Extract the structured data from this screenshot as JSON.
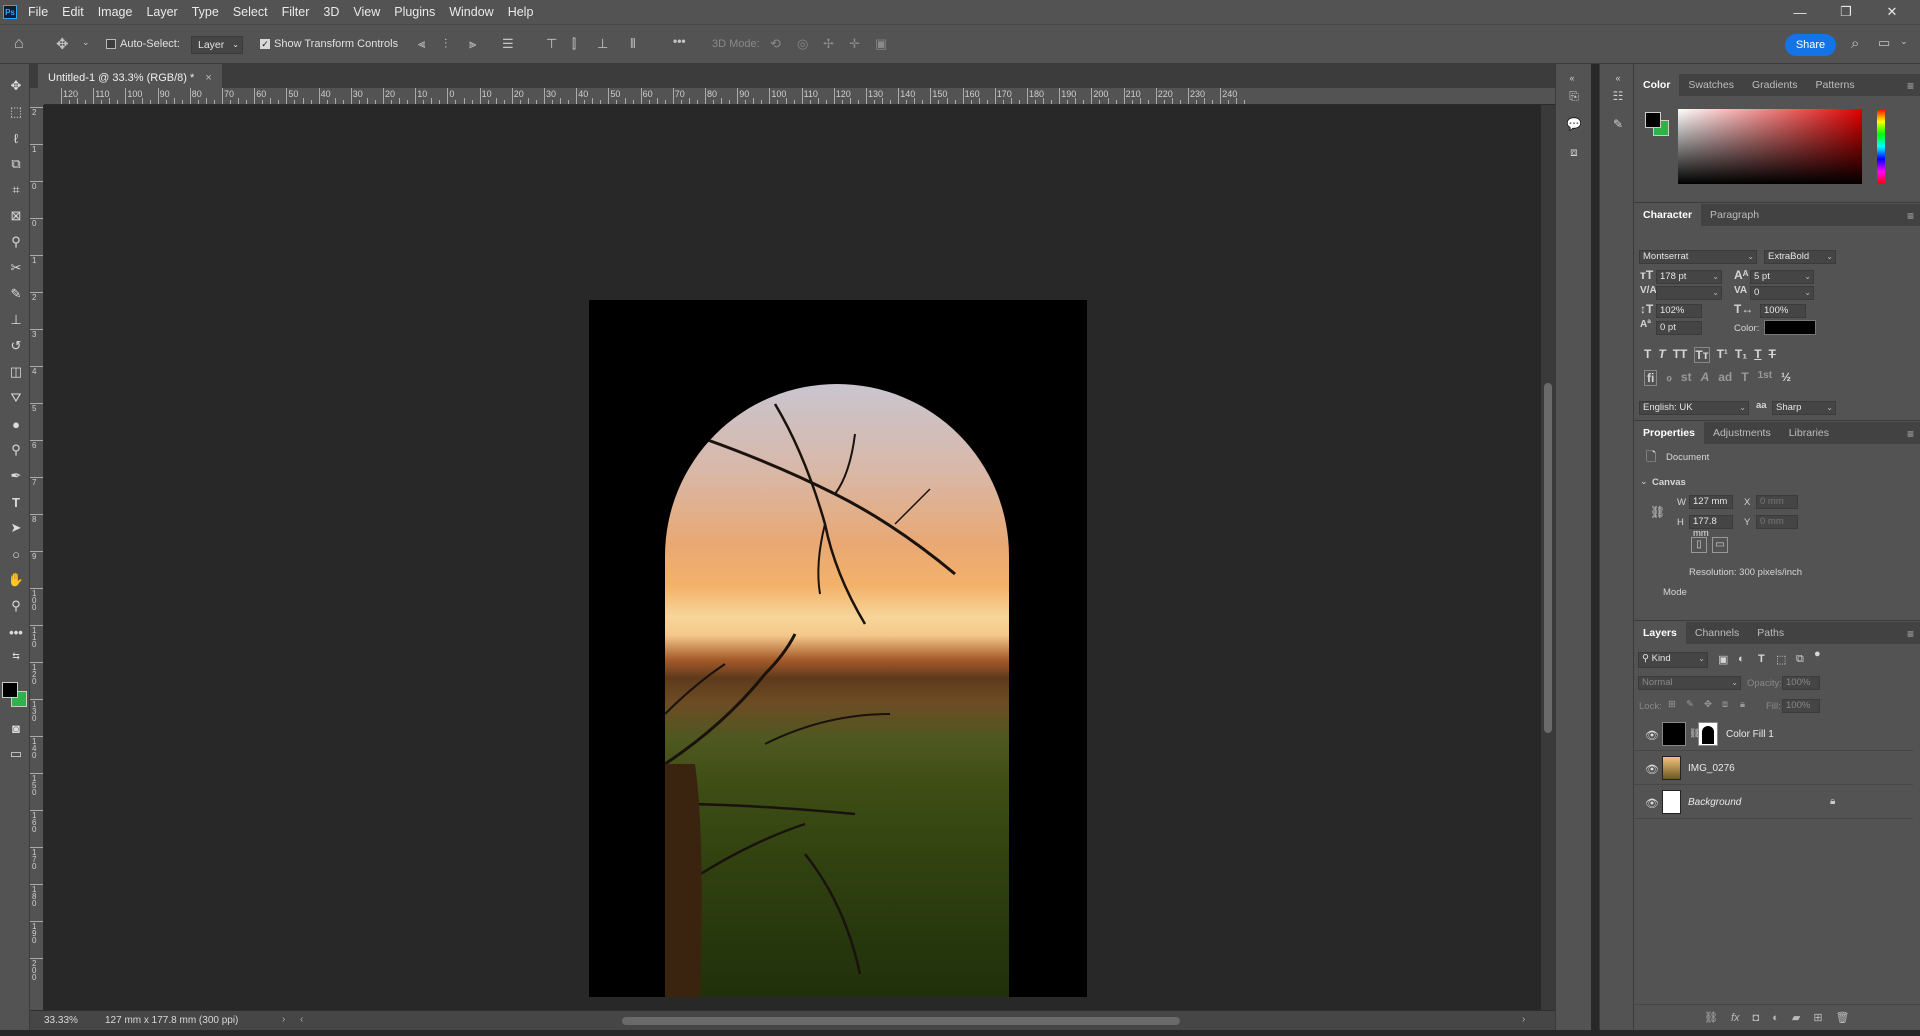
{
  "menubar": {
    "logo": "Ps",
    "items": [
      "File",
      "Edit",
      "Image",
      "Layer",
      "Type",
      "Select",
      "Filter",
      "3D",
      "View",
      "Plugins",
      "Window",
      "Help"
    ],
    "window_controls": {
      "minimize": "—",
      "restore": "❐",
      "close": "✕"
    }
  },
  "options": {
    "auto_select_label": "Auto-Select:",
    "auto_select_checked": false,
    "target_value": "Layer",
    "show_transform_label": "Show Transform Controls",
    "show_transform_checked": true,
    "mode_3d_label": "3D Mode:",
    "more_label": "•••",
    "share_label": "Share"
  },
  "document": {
    "tab_title": "Untitled-1 @ 33.3% (RGB/8) *",
    "close_glyph": "×"
  },
  "ruler": {
    "labels": [
      "120",
      "110",
      "100",
      "90",
      "80",
      "70",
      "60",
      "50",
      "40",
      "30",
      "20",
      "10",
      "0",
      "10",
      "20",
      "30",
      "40",
      "50",
      "60",
      "70",
      "80",
      "90",
      "100",
      "110",
      "120",
      "130",
      "140",
      "150",
      "160",
      "170",
      "180",
      "190",
      "200",
      "210",
      "220",
      "230",
      "240"
    ],
    "v_labels": [
      "2",
      "1",
      "0",
      "0",
      "1",
      "2",
      "3",
      "4",
      "5",
      "6",
      "7",
      "8",
      "9",
      "1 0 0",
      "1 1 0",
      "1 2 0",
      "1 3 0",
      "1 4 0",
      "1 5 0",
      "1 6 0",
      "1 7 0",
      "1 8 0",
      "1 9 0",
      "2 0 0"
    ]
  },
  "status": {
    "zoom": "33.33%",
    "doc_info": "127 mm x 177.8 mm (300 ppi)"
  },
  "color_panel": {
    "tabs": [
      "Color",
      "Swatches",
      "Gradients",
      "Patterns"
    ],
    "active_tab": "Color",
    "foreground": "#000000",
    "background": "#2db34a"
  },
  "character_panel": {
    "tabs": [
      "Character",
      "Paragraph"
    ],
    "font_family": "Montserrat",
    "font_style": "ExtraBold",
    "font_size": "178 pt",
    "leading": "5 pt",
    "kerning": "",
    "tracking": "0",
    "vertical_scale": "102%",
    "horizontal_scale": "100%",
    "baseline_shift": "0 pt",
    "color_label": "Color:",
    "language": "English: UK",
    "antialias_icon": "aa",
    "antialias": "Sharp",
    "style_buttons": [
      "T",
      "T",
      "TT",
      "Tт",
      "T¹",
      "T₁",
      "T",
      "T"
    ],
    "opentype_buttons": [
      "fi",
      "ℴ",
      "st",
      "A",
      "ad",
      "T",
      "1st",
      "½"
    ]
  },
  "properties_panel": {
    "tabs": [
      "Properties",
      "Adjustments",
      "Libraries"
    ],
    "doc_label": "Document",
    "canvas_label": "Canvas",
    "w_label": "W",
    "w_value": "127 mm",
    "h_label": "H",
    "h_value": "177.8 mm",
    "x_label": "X",
    "x_value": "0 mm",
    "y_label": "Y",
    "y_value": "0 mm",
    "resolution": "Resolution: 300 pixels/inch",
    "mode_label": "Mode"
  },
  "layers_panel": {
    "tabs": [
      "Layers",
      "Channels",
      "Paths"
    ],
    "filter_kind": "Kind",
    "blend_mode": "Normal",
    "opacity_label": "Opacity:",
    "opacity_value": "100%",
    "lock_label": "Lock:",
    "fill_label": "Fill:",
    "fill_value": "100%",
    "layers": [
      {
        "name": "Color Fill 1",
        "visible": true,
        "italic": false,
        "locked": false
      },
      {
        "name": "IMG_0276",
        "visible": true,
        "italic": false,
        "locked": false
      },
      {
        "name": "Background",
        "visible": true,
        "italic": true,
        "locked": true
      }
    ],
    "footer_icons": [
      "link-icon",
      "fx-icon",
      "mask-icon",
      "adjustment-icon",
      "group-icon",
      "new-layer-icon",
      "trash-icon"
    ]
  }
}
